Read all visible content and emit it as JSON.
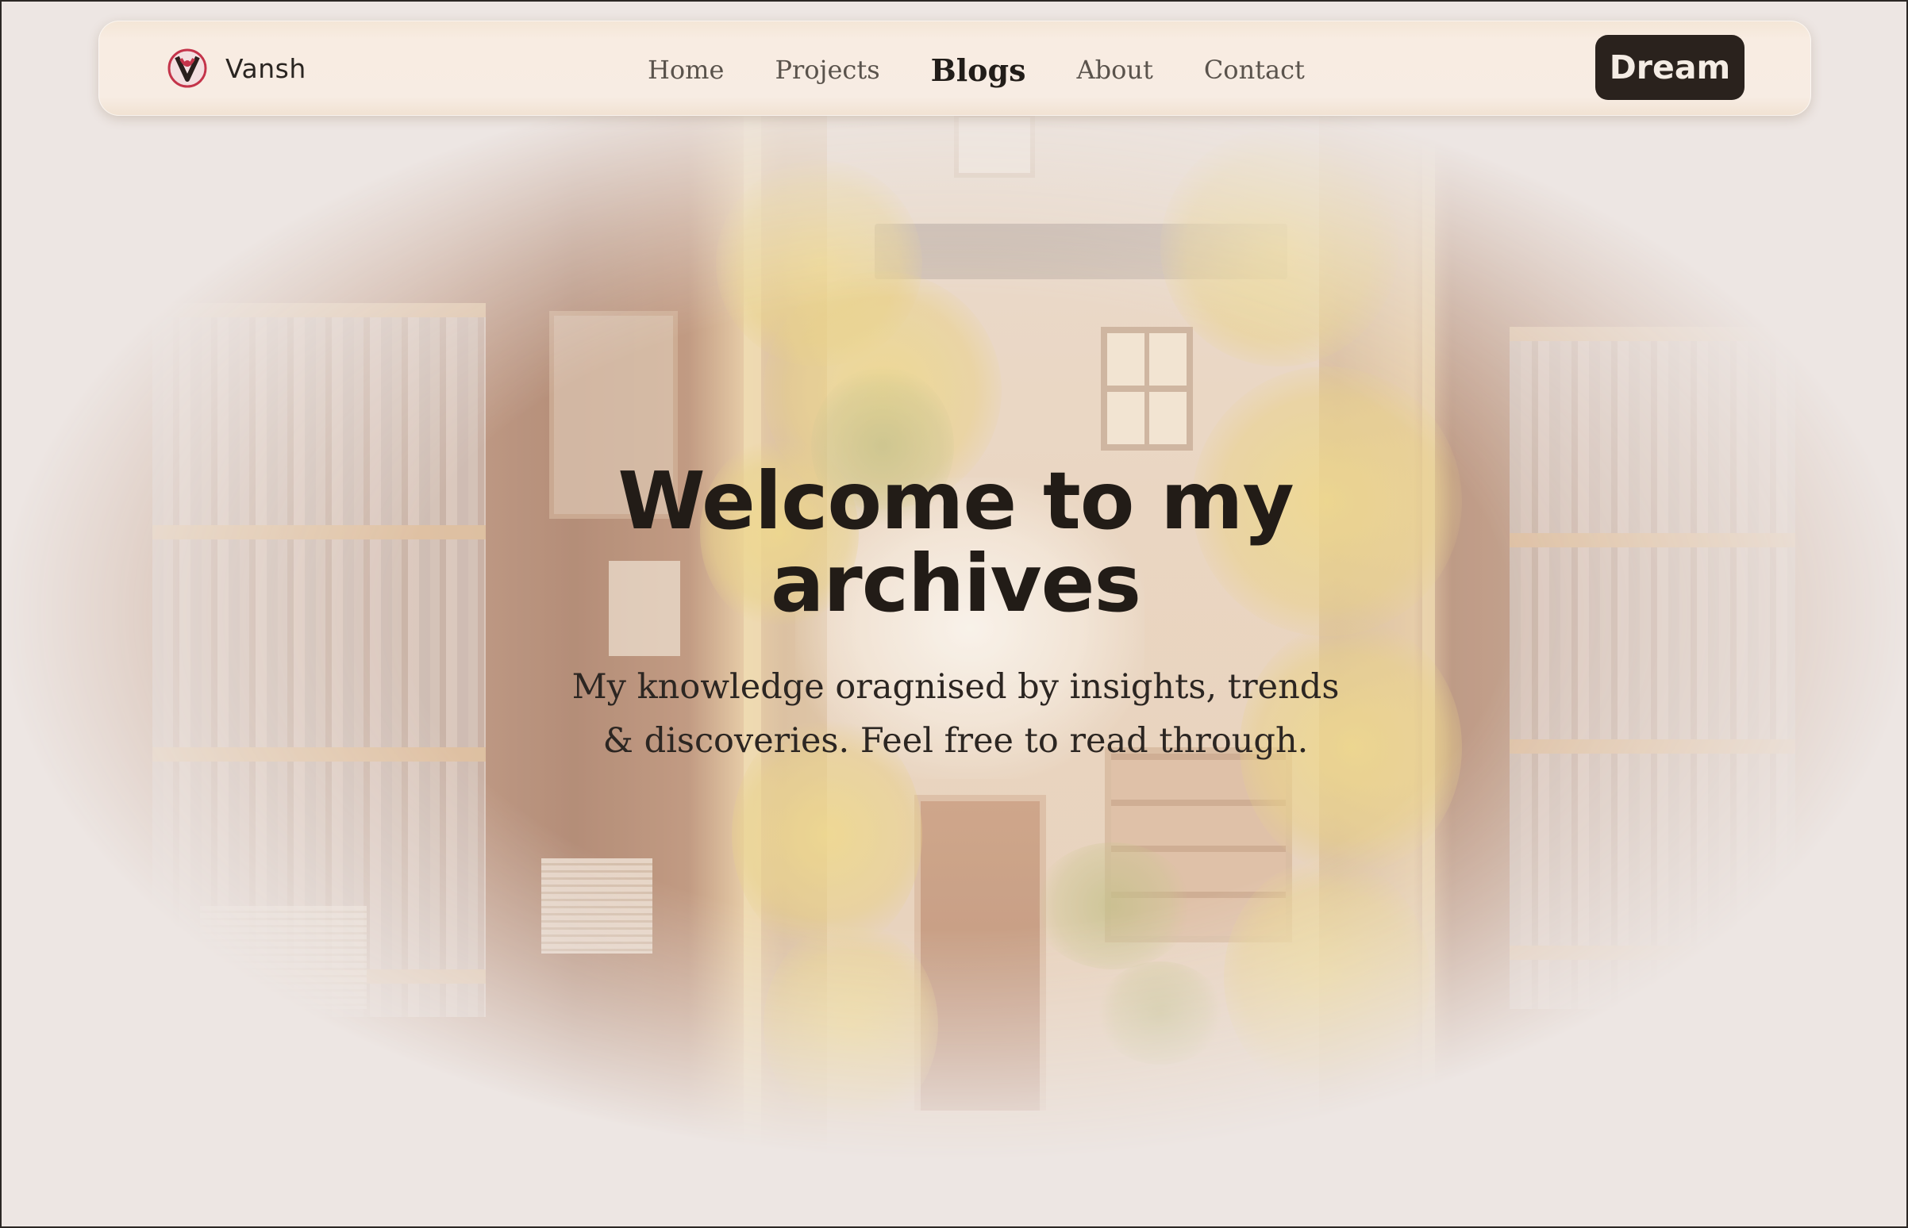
{
  "brand": {
    "name": "Vansh",
    "logo_icon": "v-logo-icon"
  },
  "nav": {
    "items": [
      {
        "label": "Home",
        "active": false
      },
      {
        "label": "Projects",
        "active": false
      },
      {
        "label": "Blogs",
        "active": true
      },
      {
        "label": "About",
        "active": false
      },
      {
        "label": "Contact",
        "active": false
      }
    ],
    "cta_label": "Dream"
  },
  "hero": {
    "title": "Welcome to my archives",
    "subtitle": "My knowledge oragnised by insights, trends & discoveries. Feel free to read through."
  },
  "colors": {
    "background": "#ede6e3",
    "navbar": "#f7ece3",
    "cta_background": "#2a221d",
    "text_dark": "#221c17",
    "logo_accent": "#c4344a"
  }
}
